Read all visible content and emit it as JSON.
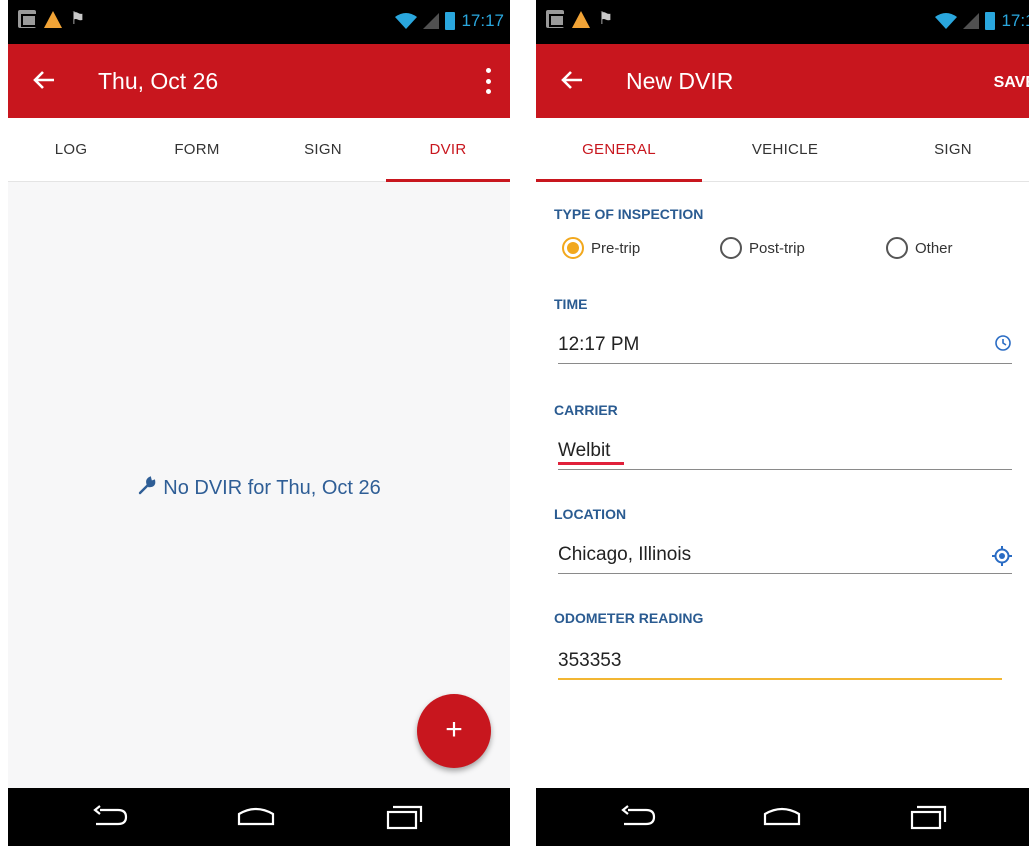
{
  "status_bar": {
    "time": "17:17"
  },
  "left_screen": {
    "title": "Thu, Oct 26",
    "tabs": [
      {
        "label": "LOG"
      },
      {
        "label": "FORM"
      },
      {
        "label": "SIGN"
      },
      {
        "label": "DVIR",
        "active": true
      }
    ],
    "empty_message": "No DVIR for Thu, Oct 26",
    "fab_label": "+"
  },
  "right_screen": {
    "title": "New DVIR",
    "save_label": "SAVE",
    "tabs": [
      {
        "label": "GENERAL",
        "active": true
      },
      {
        "label": "VEHICLE"
      },
      {
        "label": "SIGN"
      }
    ],
    "form": {
      "inspection_type": {
        "label": "TYPE OF INSPECTION",
        "options": [
          "Pre-trip",
          "Post-trip",
          "Other"
        ],
        "selected": "Pre-trip"
      },
      "time": {
        "label": "TIME",
        "value": "12:17 PM"
      },
      "carrier": {
        "label": "CARRIER",
        "value": "Welbit"
      },
      "location": {
        "label": "LOCATION",
        "value": "Chicago, Illinois"
      },
      "odometer": {
        "label": "ODOMETER READING",
        "value": "353353"
      }
    }
  },
  "colors": {
    "app_bar": "#c8161e",
    "label_blue": "#2a5b91",
    "radio_selected": "#f2a81d",
    "focus_underline": "#f2b632",
    "status_icons": "#2aa7de"
  },
  "icons": {
    "back": "arrow-left-icon",
    "more": "overflow-menu-icon",
    "wrench": "wrench-icon",
    "clock": "clock-icon",
    "gps": "gps-target-icon",
    "nav_back": "nav-back-icon",
    "nav_home": "nav-home-icon",
    "nav_recents": "nav-recents-icon"
  }
}
